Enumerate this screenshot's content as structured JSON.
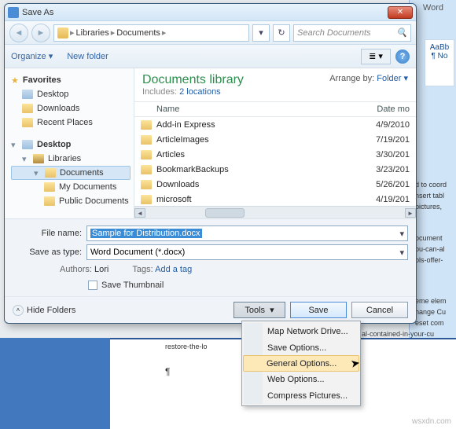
{
  "bg": {
    "word_label": "Word",
    "style_preview": "AaBb",
    "style_name": "¶ No",
    "text_fragments": [
      "d to coord",
      "nsert tabl",
      "pictures,",
      "ocument",
      "ou-can-al",
      "ols-offer-",
      "eme elem",
      "hange Cu",
      "eset com",
      "al-contained-in-your-cu",
      "restore-the-lo"
    ],
    "pilcrow": "¶"
  },
  "dialog": {
    "title": "Save As",
    "breadcrumb": [
      "Libraries",
      "Documents"
    ],
    "search_placeholder": "Search Documents",
    "toolbar": {
      "organize": "Organize",
      "new_folder": "New folder"
    },
    "tree": {
      "favorites": "Favorites",
      "desktop": "Desktop",
      "downloads": "Downloads",
      "recent": "Recent Places",
      "desktop2": "Desktop",
      "libraries": "Libraries",
      "documents": "Documents",
      "my_documents": "My Documents",
      "public_documents": "Public Documents"
    },
    "lib": {
      "title": "Documents library",
      "includes": "Includes:",
      "locations": "2 locations",
      "arrange_by": "Arrange by:",
      "arrange_val": "Folder"
    },
    "columns": {
      "name": "Name",
      "date": "Date mo"
    },
    "files": [
      {
        "name": "Add-in Express",
        "date": "4/9/2010"
      },
      {
        "name": "ArticleImages",
        "date": "7/19/201"
      },
      {
        "name": "Articles",
        "date": "3/30/201"
      },
      {
        "name": "BookmarkBackups",
        "date": "3/23/201"
      },
      {
        "name": "Downloads",
        "date": "5/26/201"
      },
      {
        "name": "microsoft",
        "date": "4/19/201"
      }
    ],
    "form": {
      "filename_label": "File name:",
      "filename_value": "Sample for Distribution.docx",
      "type_label": "Save as type:",
      "type_value": "Word Document (*.docx)",
      "authors_label": "Authors:",
      "authors_value": "Lori",
      "tags_label": "Tags:",
      "tags_value": "Add a tag",
      "thumbnail": "Save Thumbnail"
    },
    "footer": {
      "hide": "Hide Folders",
      "tools": "Tools",
      "save": "Save",
      "cancel": "Cancel"
    }
  },
  "menu": {
    "items": [
      "Map Network Drive...",
      "Save Options...",
      "General Options...",
      "Web Options...",
      "Compress Pictures..."
    ],
    "hover_index": 2
  },
  "watermark": "wsxdn.com"
}
